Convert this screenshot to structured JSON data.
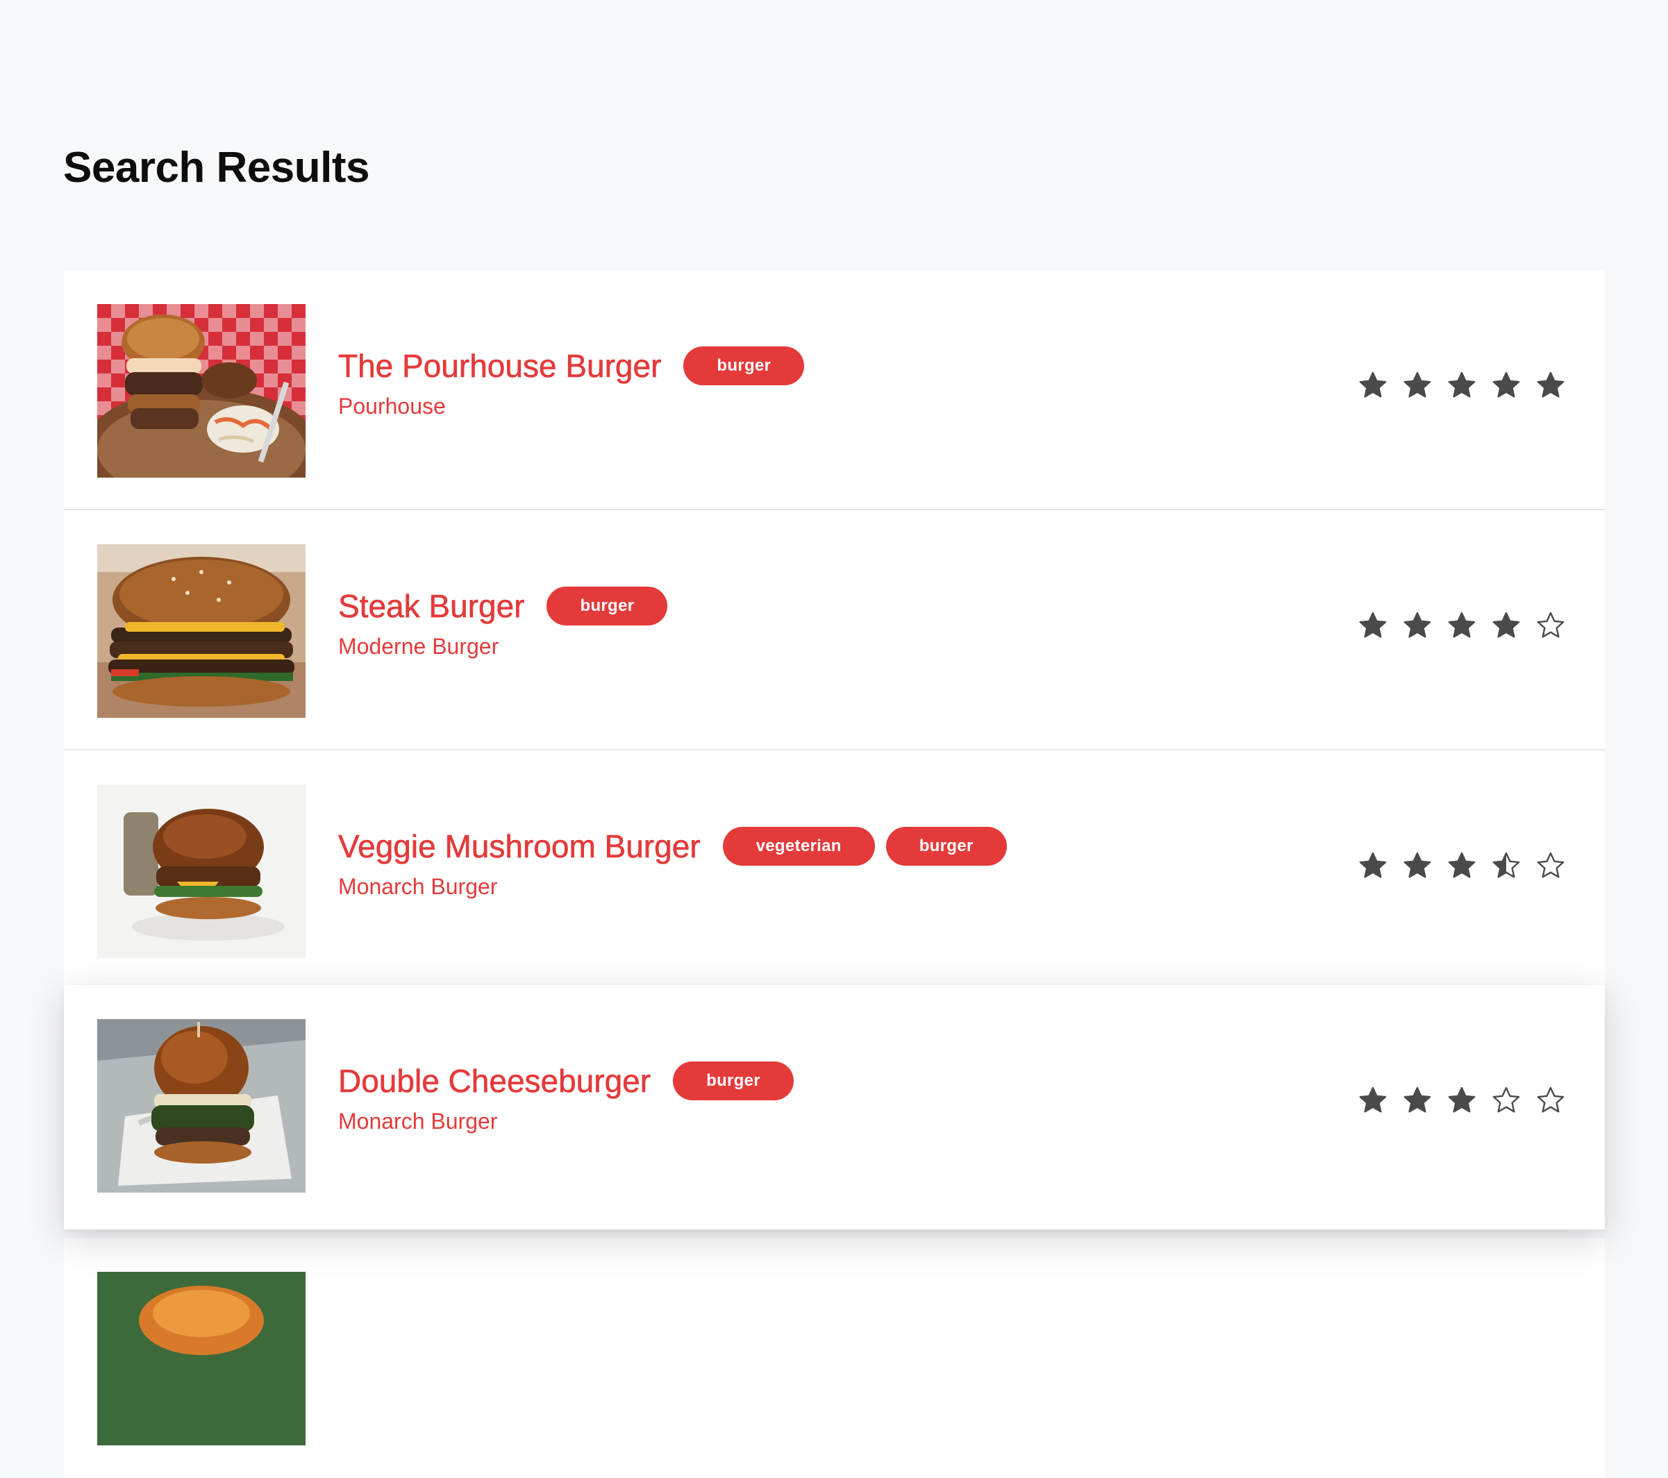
{
  "page": {
    "title": "Search Results"
  },
  "colors": {
    "accent": "#e43a3a",
    "star": "#4a4a4a",
    "background": "#f7f8fa",
    "card": "#ffffff"
  },
  "results": [
    {
      "name": "The Pourhouse Burger",
      "restaurant": "Pourhouse",
      "tags": [
        "burger"
      ],
      "rating": 5,
      "image": "burger-with-coleslaw-on-checkered-cloth"
    },
    {
      "name": "Steak Burger",
      "restaurant": "Moderne Burger",
      "tags": [
        "burger"
      ],
      "rating": 4,
      "image": "double-patty-cheeseburger"
    },
    {
      "name": "Veggie Mushroom Burger",
      "restaurant": "Monarch Burger",
      "tags": [
        "vegeterian",
        "burger"
      ],
      "rating": 3.5,
      "image": "pretzel-bun-burger-white-background"
    },
    {
      "name": "Double Cheeseburger",
      "restaurant": "Monarch Burger",
      "tags": [
        "burger"
      ],
      "rating": 3,
      "image": "burger-in-paper-wrap-on-tray"
    },
    {
      "image": "partially-visible-burger"
    }
  ]
}
